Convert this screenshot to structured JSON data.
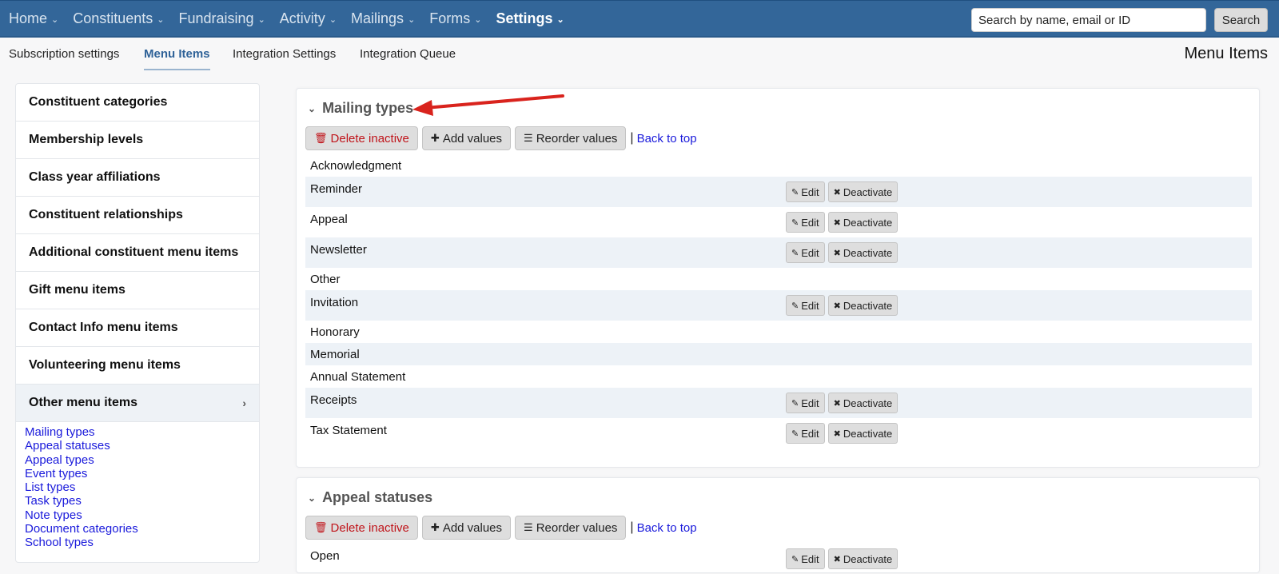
{
  "topnav": {
    "items": [
      {
        "label": "Home",
        "active": false
      },
      {
        "label": "Constituents",
        "active": false
      },
      {
        "label": "Fundraising",
        "active": false
      },
      {
        "label": "Activity",
        "active": false
      },
      {
        "label": "Mailings",
        "active": false
      },
      {
        "label": "Forms",
        "active": false
      },
      {
        "label": "Settings",
        "active": true
      }
    ],
    "search_placeholder": "Search by name, email or ID",
    "search_button": "Search"
  },
  "subnav": {
    "tabs": [
      {
        "label": "Subscription settings",
        "active": false
      },
      {
        "label": "Menu Items",
        "active": true
      },
      {
        "label": "Integration Settings",
        "active": false
      },
      {
        "label": "Integration Queue",
        "active": false
      }
    ],
    "page_title": "Menu Items"
  },
  "sidebar": {
    "items": [
      {
        "label": "Constituent categories"
      },
      {
        "label": "Membership levels"
      },
      {
        "label": "Class year affiliations"
      },
      {
        "label": "Constituent relationships"
      },
      {
        "label": "Additional constituent menu items"
      },
      {
        "label": "Gift menu items"
      },
      {
        "label": "Contact Info menu items"
      },
      {
        "label": "Volunteering menu items"
      },
      {
        "label": "Other menu items",
        "active": true
      }
    ],
    "sub_links": [
      "Mailing types",
      "Appeal statuses",
      "Appeal types",
      "Event types",
      "List types",
      "Task types",
      "Note types",
      "Document categories",
      "School types"
    ]
  },
  "buttons": {
    "delete_inactive": "Delete inactive",
    "add_values": "Add values",
    "reorder_values": "Reorder values",
    "back_to_top": "Back to top",
    "edit": "Edit",
    "deactivate": "Deactivate",
    "separator": "|"
  },
  "icons": {
    "chevron_down": "⌄",
    "chevron_right": "›",
    "trash": "🗑",
    "plus": "✚",
    "list": "☰",
    "pencil": "✎",
    "times": "✖"
  },
  "sections": [
    {
      "title": "Mailing types",
      "rows": [
        {
          "name": "Acknowledgment",
          "editable": false
        },
        {
          "name": "Reminder",
          "editable": true
        },
        {
          "name": "Appeal",
          "editable": true
        },
        {
          "name": "Newsletter",
          "editable": true
        },
        {
          "name": "Other",
          "editable": false
        },
        {
          "name": "Invitation",
          "editable": true
        },
        {
          "name": "Honorary",
          "editable": false
        },
        {
          "name": "Memorial",
          "editable": false
        },
        {
          "name": "Annual Statement",
          "editable": false
        },
        {
          "name": "Receipts",
          "editable": true
        },
        {
          "name": "Tax Statement",
          "editable": true
        }
      ]
    },
    {
      "title": "Appeal statuses",
      "rows": [
        {
          "name": "Open",
          "editable": true
        }
      ]
    }
  ],
  "colors": {
    "nav_bg": "#336699",
    "link": "#1a1adb",
    "danger": "#c0141a",
    "row_alt": "#edf2f7",
    "annotation_arrow": "#d9231d"
  }
}
